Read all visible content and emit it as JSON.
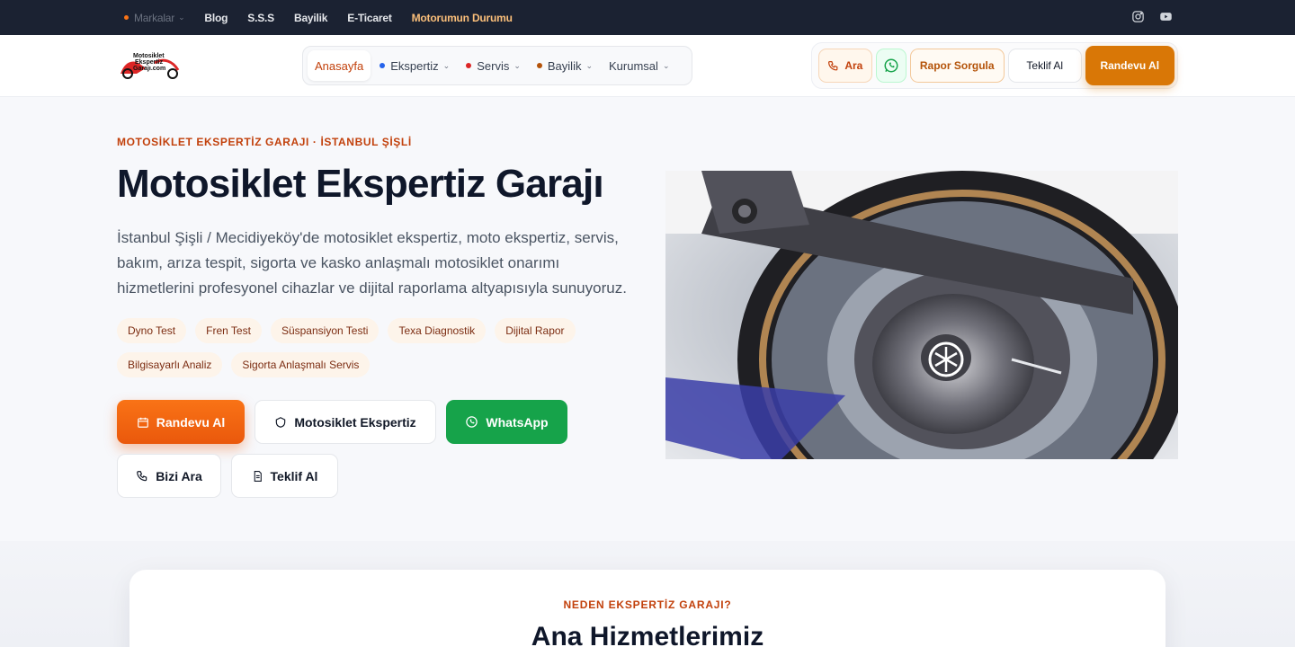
{
  "topbar": {
    "links": [
      {
        "label": "Markalar",
        "dropdown": true
      },
      {
        "label": "Blog"
      },
      {
        "label": "S.S.S"
      },
      {
        "label": "Bayilik"
      },
      {
        "label": "E-Ticaret"
      },
      {
        "label": "Motorumun Durumu"
      }
    ],
    "social": [
      "instagram-icon",
      "youtube-icon"
    ]
  },
  "header": {
    "logo_text": [
      "Motosiklet",
      "Ekspertiz",
      "Garajı.com"
    ],
    "nav": [
      {
        "label": "Anasayfa",
        "active": true
      },
      {
        "label": "Ekspertiz",
        "dot_color": "#2563eb"
      },
      {
        "label": "Servis",
        "dot_color": "#dc2626"
      },
      {
        "label": "Bayilik",
        "dot_color": "#b45309"
      },
      {
        "label": "Kurumsal"
      }
    ],
    "actions": {
      "ara": "Ara",
      "rapor": "Rapor Sorgula",
      "teklif": "Teklif Al",
      "randevu": "Randevu Al"
    }
  },
  "hero": {
    "eyebrow": "MOTOSİKLET EKSPERTİZ GARAJI · İSTANBUL ŞİŞLİ",
    "title": "Motosiklet Ekspertiz Garajı",
    "description": "İstanbul Şişli / Mecidiyeköy'de motosiklet ekspertiz, moto ekspertiz, servis, bakım, arıza tespit, sigorta ve kasko anlaşmalı motosiklet onarımı hizmetlerini profesyonel cihazlar ve dijital raporlama altyapısıyla sunuyoruz.",
    "chips": [
      "Dyno Test",
      "Fren Test",
      "Süspansiyon Testi",
      "Texa Diagnostik",
      "Dijital Rapor",
      "Bilgisayarlı Analiz",
      "Sigorta Anlaşmalı Servis"
    ],
    "buttons": {
      "randevu": "Randevu Al",
      "ekspertiz": "Motosiklet Ekspertiz",
      "whatsapp": "WhatsApp",
      "ara": "Bizi Ara",
      "teklif": "Teklif Al"
    }
  },
  "section": {
    "eyebrow": "NEDEN EKSPERTİZ GARAJI?",
    "title": "Ana Hizmetlerimiz"
  },
  "colors": {
    "accent": "#ea580c",
    "brand_dark": "#1b2232",
    "whatsapp": "#16a34a"
  }
}
